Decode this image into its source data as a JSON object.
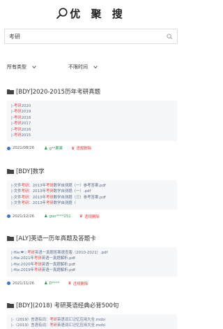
{
  "header": {
    "title": "优 聚 搜"
  },
  "search": {
    "value": "考研"
  },
  "filters": {
    "type": "所有类型",
    "time": "不限时间"
  },
  "results": [
    {
      "title": "[BDY]2020-2015历年考研真题",
      "files": [
        "|-考研2020",
        "|-考研2019",
        "|-考研2018",
        "|-考研2017",
        "|-考研2016",
        "|-考研2015"
      ],
      "date": "2021/08/26",
      "user": "g**果果",
      "delete": "违规删除"
    },
    {
      "title": "[BDY]数学",
      "files": [
        "|-文件考研：2013年考研数学自测题（一）参考答案.pdf",
        "|-文件考研：2013年考研数学自测题（一）.pdf",
        "|-文件考研：2013年考研数学自测题（三）参考答案.pdf",
        "|-文件考研：2013年考研数学自测题（"
      ],
      "date": "2021/12/26",
      "user": "guo****251",
      "delete": "违规删除"
    },
    {
      "title": "[ALY]英语一历年真题及答题卡",
      "files": [
        "|-file:❤☆考研英语一真题答案速查版（2010-2021）.pdf",
        "|-file:2021年考研英语一真题解析.pdf",
        "|-file:2020年考研英语一真题解析.pdf",
        "|-file:2019年考研英语一真题解析.pdf"
      ],
      "date": "2021/11/26",
      "user": "D****",
      "delete": "违规删除"
    },
    {
      "title": "[BDY](2018) 考研英语经典必背500句",
      "files": [
        "|-（2019）言语有词：考研英语词汇记忆应用大全.mobi",
        "|-（2019）言语有词：考研英语词汇记忆应用大全.mobi"
      ],
      "date": "",
      "user": "",
      "delete": ""
    }
  ]
}
